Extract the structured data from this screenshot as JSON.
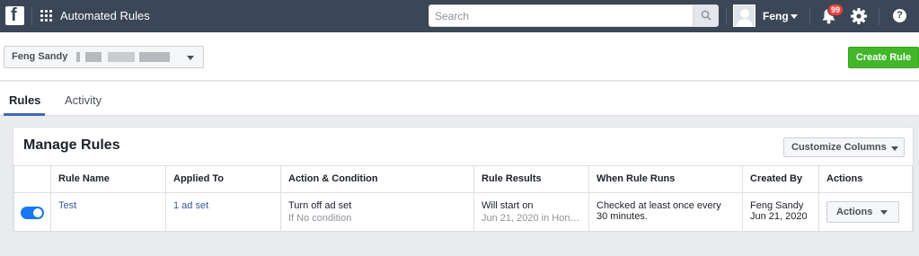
{
  "header": {
    "app_title": "Automated Rules",
    "search_placeholder": "Search",
    "user_name": "Feng",
    "notification_count": "99",
    "help_glyph": "?"
  },
  "account": {
    "name": "Feng Sandy",
    "create_rule_label": "Create Rule"
  },
  "tabs": [
    {
      "label": "Rules",
      "active": true
    },
    {
      "label": "Activity",
      "active": false
    }
  ],
  "manage": {
    "title": "Manage Rules",
    "customize_label": "Customize Columns",
    "columns": [
      "",
      "Rule Name",
      "Applied To",
      "Action & Condition",
      "Rule Results",
      "When Rule Runs",
      "Created By",
      "Actions"
    ],
    "rows": [
      {
        "enabled": true,
        "rule_name": "Test",
        "applied_to": "1 ad set",
        "action": "Turn off ad set",
        "condition": "If No condition",
        "result": "Will start on",
        "result_sub": "Jun 21, 2020 in Hon…",
        "when_runs": "Checked at least once every 30 minutes.",
        "created_by": "Feng Sandy",
        "created_date": "Jun 21, 2020",
        "actions_label": "Actions"
      }
    ]
  },
  "colors": {
    "topbar": "#3b4656",
    "accent_blue": "#4267b2",
    "create_green": "#42b72a",
    "toggle_on": "#1877f2",
    "badge_red": "#fa3e3e"
  }
}
